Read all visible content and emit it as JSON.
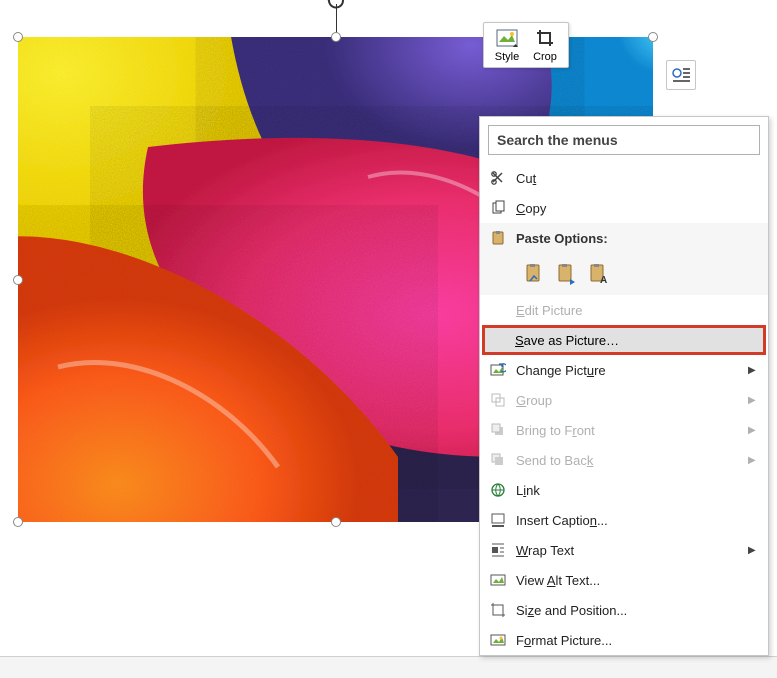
{
  "image": {
    "rotation_handle": "rotate"
  },
  "mini_toolbar": {
    "style_label": "Style",
    "crop_label": "Crop"
  },
  "layout_button": {
    "name": "layout-options"
  },
  "context_menu": {
    "search_placeholder": "Search the menus",
    "items": {
      "cut": "Cut",
      "copy": "Copy",
      "paste_header": "Paste Options:",
      "paste_options": {
        "keep_source": "keep-source-formatting",
        "picture": "paste-picture",
        "keep_text": "keep-text-only"
      },
      "edit_picture": "Edit Picture",
      "save_as_picture": "Save as Picture…",
      "change_picture": "Change Picture",
      "group": "Group",
      "bring_front": "Bring to Front",
      "send_back": "Send to Back",
      "link": "Link",
      "insert_caption": "Insert Caption...",
      "wrap_text": "Wrap Text",
      "view_alt_text": "View Alt Text...",
      "size_position": "Size and Position...",
      "format_picture": "Format Picture..."
    }
  }
}
